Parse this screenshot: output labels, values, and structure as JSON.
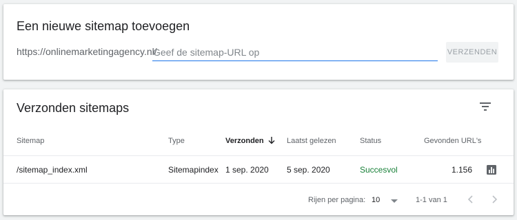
{
  "add_card": {
    "title": "Een nieuwe sitemap toevoegen",
    "url_prefix": "https://onlinemarketingagency.nl/",
    "input_placeholder": "Geef de sitemap-URL op",
    "input_value": "",
    "submit_label": "VERZENDEN"
  },
  "list_card": {
    "title": "Verzonden sitemaps",
    "filter_icon": "filter-list-icon",
    "columns": [
      "Sitemap",
      "Type",
      "Verzonden",
      "Laatst gelezen",
      "Status",
      "Gevonden URL's"
    ],
    "sorted_column": "Verzonden",
    "sort_direction": "descending",
    "rows": [
      {
        "sitemap": "/sitemap_index.xml",
        "type": "Sitemapindex",
        "submitted": "1 sep. 2020",
        "last_read": "5 sep. 2020",
        "status": "Succesvol",
        "found_urls": "1.156",
        "action_icon": "bar-chart-icon"
      }
    ],
    "footer": {
      "rows_per_page_label": "Rijen per pagina:",
      "rows_per_page_value": "10",
      "range_text": "1-1 van 1"
    }
  },
  "colors": {
    "accent": "#1a73e8",
    "success": "#188038",
    "background": "#f1f3f4"
  }
}
